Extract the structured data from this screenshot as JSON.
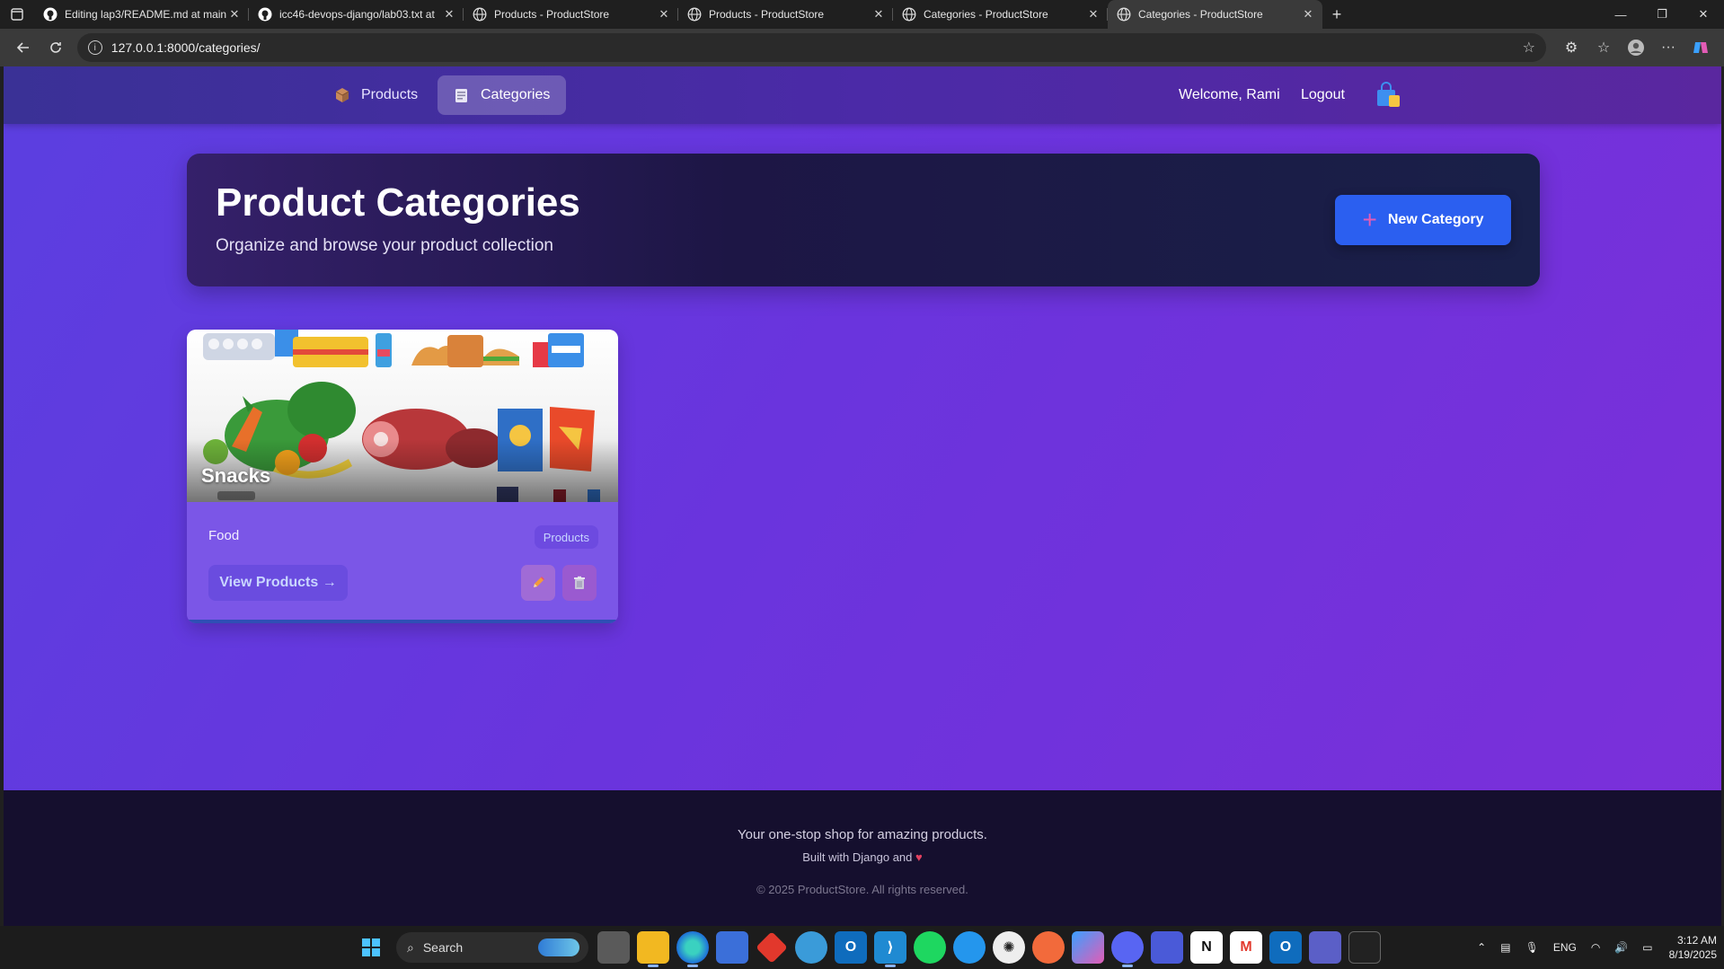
{
  "browser": {
    "tabs": [
      {
        "title": "Editing lap3/README.md at main",
        "icon": "github-icon",
        "active": false
      },
      {
        "title": "icc46-devops-django/lab03.txt at",
        "icon": "github-icon",
        "active": false
      },
      {
        "title": "Products - ProductStore",
        "icon": "globe-icon",
        "active": false
      },
      {
        "title": "Products - ProductStore",
        "icon": "globe-icon",
        "active": false
      },
      {
        "title": "Categories - ProductStore",
        "icon": "globe-icon",
        "active": false
      },
      {
        "title": "Categories - ProductStore",
        "icon": "globe-icon",
        "active": true
      }
    ],
    "url": "127.0.0.1:8000/categories/"
  },
  "nav": {
    "products_label": "Products",
    "categories_label": "Categories",
    "welcome": "Welcome, Rami",
    "logout_label": "Logout"
  },
  "hero": {
    "title": "Product Categories",
    "subtitle": "Organize and browse your product collection",
    "new_button_label": "New Category"
  },
  "categories": [
    {
      "name": "Snacks",
      "description": "Food",
      "badge": "Products",
      "view_label": "View Products →"
    }
  ],
  "footer": {
    "line1": "Your one-stop shop for amazing products.",
    "line2": "Built with Django and",
    "line3": "© 2025 ProductStore. All rights reserved."
  },
  "taskbar": {
    "search_placeholder": "Search",
    "lang": "ENG",
    "time": "3:12 AM",
    "date": "8/19/2025"
  },
  "colors": {
    "accent": "#2b5ff0",
    "page_bg_start": "#5b3fe0",
    "page_bg_end": "#7c2fd9",
    "footer_bg": "#150f2e"
  }
}
